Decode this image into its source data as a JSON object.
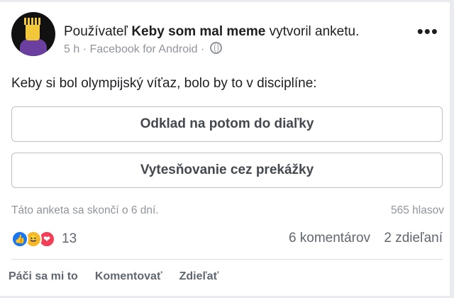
{
  "post": {
    "header_prefix": "Používateľ",
    "author": "Keby som mal meme",
    "header_suffix": "vytvoril anketu.",
    "time": "5 h",
    "source": "Facebook for Android",
    "separator": "·",
    "more_glyph": "•••",
    "question": "Keby si bol olympijský víťaz, bolo by to v disciplíne:"
  },
  "poll": {
    "options": [
      {
        "label": "Odklad na potom do diaľky"
      },
      {
        "label": "Vytesňovanie cez prekážky"
      }
    ],
    "ends_text": "Táto anketa sa skončí o 6 dní.",
    "votes_text": "565 hlasov"
  },
  "reactions": {
    "icons": [
      "like-icon",
      "haha-icon",
      "love-icon"
    ],
    "count": "13",
    "comments": "6 komentárov",
    "shares": "2 zdieľaní"
  },
  "actions": {
    "like": "Páči sa mi to",
    "comment": "Komentovať",
    "share": "Zdieľať"
  },
  "colors": {
    "like": "#1877f2",
    "haha": "#f7b928",
    "love": "#f33e58"
  }
}
